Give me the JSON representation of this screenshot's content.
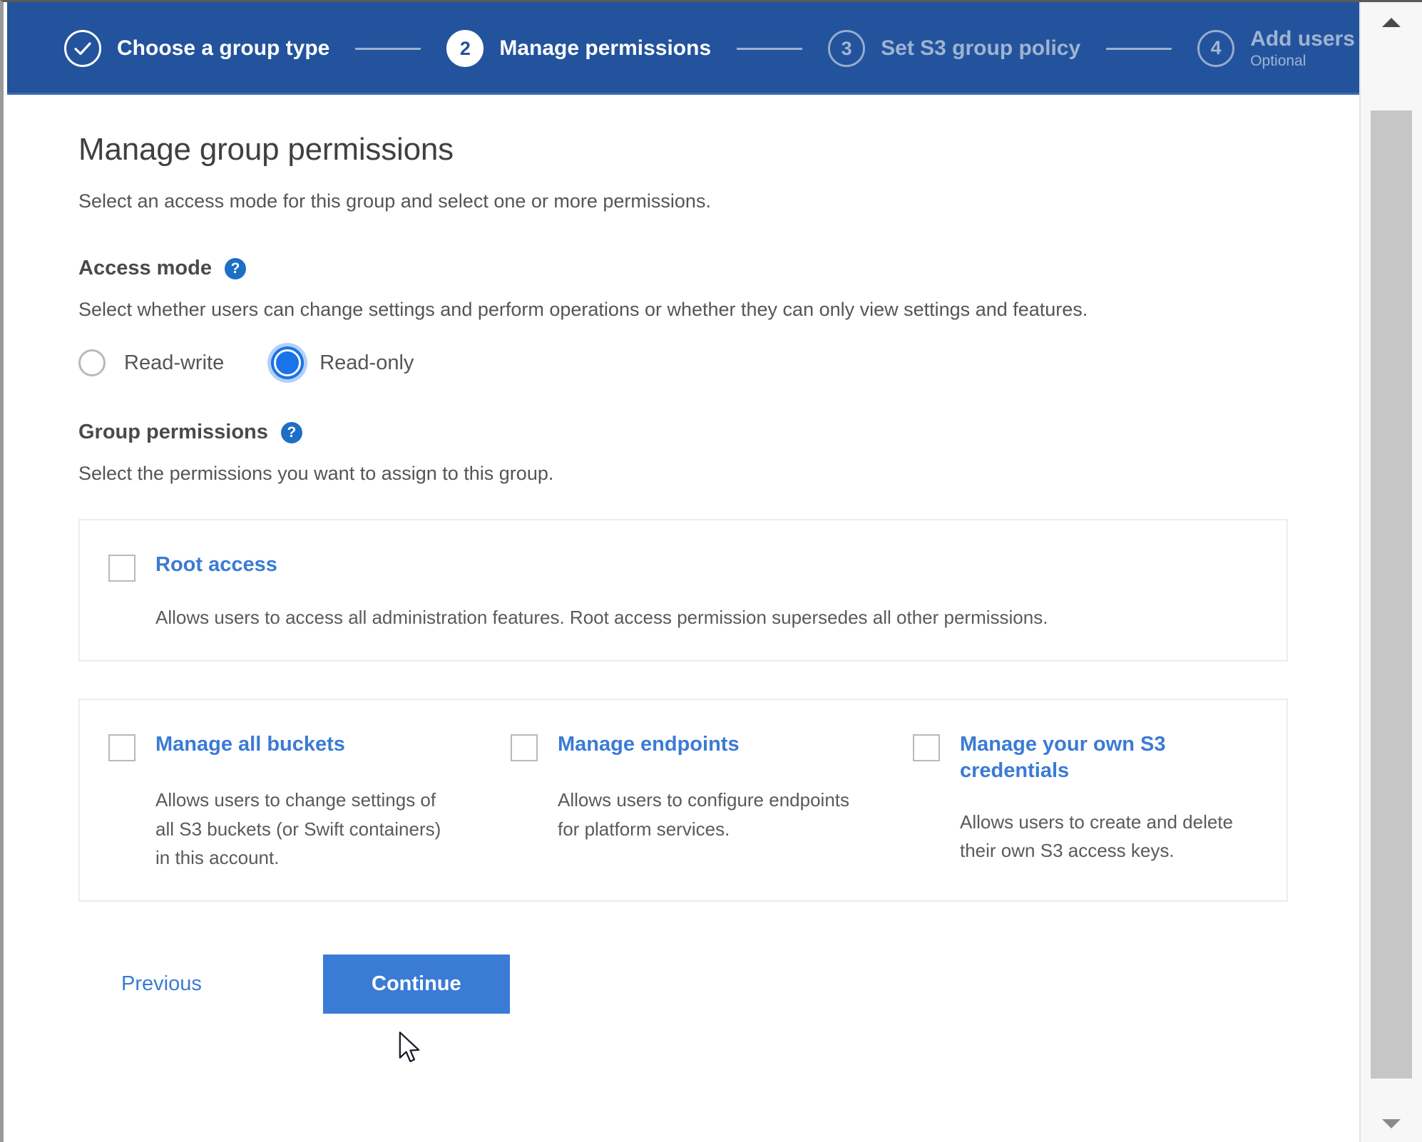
{
  "wizard": {
    "steps": [
      {
        "number": "1",
        "label": "Choose a group type",
        "state": "done",
        "icon": "check-icon"
      },
      {
        "number": "2",
        "label": "Manage permissions",
        "state": "active",
        "icon": ""
      },
      {
        "number": "3",
        "label": "Set S3 group policy",
        "state": "upcoming",
        "icon": ""
      },
      {
        "number": "4",
        "label": "Add users",
        "state": "upcoming",
        "icon": "",
        "sublabel": "Optional"
      }
    ]
  },
  "page": {
    "title": "Manage group permissions",
    "subtitle": "Select an access mode for this group and select one or more permissions."
  },
  "access_mode": {
    "label": "Access mode",
    "help_glyph": "?",
    "description": "Select whether users can change settings and perform operations or whether they can only view settings and features.",
    "options": [
      {
        "label": "Read-write",
        "selected": false
      },
      {
        "label": "Read-only",
        "selected": true
      }
    ]
  },
  "group_permissions": {
    "label": "Group permissions",
    "help_glyph": "?",
    "description": "Select the permissions you want to assign to this group.",
    "root_card": [
      {
        "title": "Root access",
        "description": "Allows users to access all administration features. Root access permission supersedes all other permissions.",
        "checked": false
      }
    ],
    "permissions_card": [
      {
        "title": "Manage all buckets",
        "description": "Allows users to change settings of all S3 buckets (or Swift containers) in this account.",
        "checked": false
      },
      {
        "title": "Manage endpoints",
        "description": "Allows users to configure endpoints for platform services.",
        "checked": false
      },
      {
        "title": "Manage your own S3 credentials",
        "description": "Allows users to create and delete their own S3 access keys.",
        "checked": false
      }
    ]
  },
  "actions": {
    "previous_label": "Previous",
    "continue_label": "Continue"
  },
  "colors": {
    "header_blue": "#23539c",
    "accent_blue": "#3a7bd5",
    "radio_blue": "#1a73e8",
    "help_blue": "#1d6fc4",
    "text_gray": "#555555"
  }
}
